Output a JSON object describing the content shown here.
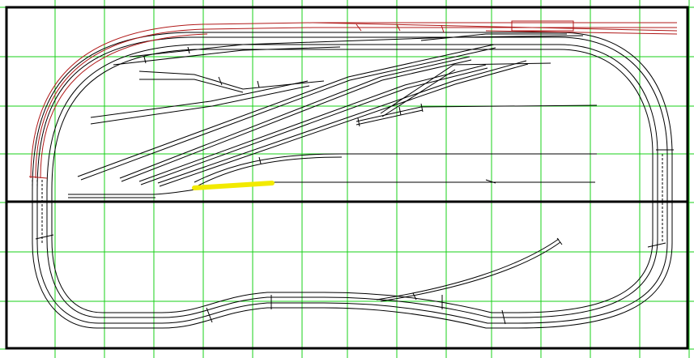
{
  "diagram": {
    "background_color": "#ffffff",
    "grid_color": "#19d219",
    "frame_color": "#000000",
    "track_color": "#000000",
    "highlight_track_color": "#b01818",
    "marker_color": "#f2ea00",
    "modules": 2,
    "grid": "on"
  }
}
